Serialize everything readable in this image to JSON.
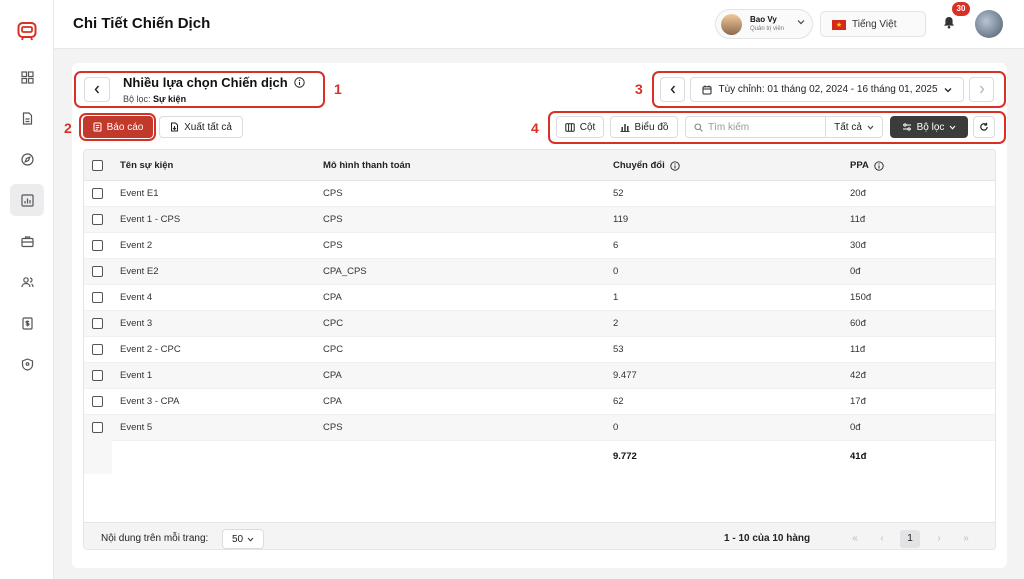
{
  "header": {
    "title": "Chi Tiết Chiến Dịch",
    "user_name": "Bao Vy",
    "user_role": "Quản trị viên",
    "language": "Tiếng Việt",
    "notifications": "30"
  },
  "annotations": [
    "1",
    "2",
    "3",
    "4"
  ],
  "campaign": {
    "title": "Nhiều lựa chọn Chiến dịch",
    "filter_label": "Bộ lọc:",
    "filter_value": "Sự kiện"
  },
  "date_range": "Tùy chỉnh: 01 tháng 02, 2024 - 16 tháng 01, 2025",
  "toolbar": {
    "report": "Báo cáo",
    "export_all": "Xuất tất cả",
    "columns": "Cột",
    "chart": "Biểu đồ",
    "search_placeholder": "Tìm kiếm",
    "scope": "Tất cả",
    "filter": "Bộ lọc"
  },
  "table": {
    "headers": [
      "Tên sự kiện",
      "Mô hình thanh toán",
      "Chuyển đổi",
      "PPA"
    ],
    "rows": [
      [
        "Event E1",
        "CPS",
        "52",
        "20đ"
      ],
      [
        "Event 1 - CPS",
        "CPS",
        "119",
        "11đ"
      ],
      [
        "Event 2",
        "CPS",
        "6",
        "30đ"
      ],
      [
        "Event E2",
        "CPA_CPS",
        "0",
        "0đ"
      ],
      [
        "Event 4",
        "CPA",
        "1",
        "150đ"
      ],
      [
        "Event 3",
        "CPC",
        "2",
        "60đ"
      ],
      [
        "Event 2 - CPC",
        "CPC",
        "53",
        "11đ"
      ],
      [
        "Event 1",
        "CPA",
        "9.477",
        "42đ"
      ],
      [
        "Event 3 - CPA",
        "CPA",
        "62",
        "17đ"
      ],
      [
        "Event 5",
        "CPS",
        "0",
        "0đ"
      ]
    ],
    "total": {
      "conversions": "9.772",
      "ppa": "41đ"
    }
  },
  "pagination": {
    "per_page_label": "Nội dung trên mỗi trang:",
    "per_page": "50",
    "range": "1 - 10 của 10 hàng",
    "current_page": "1"
  },
  "colors": {
    "accent": "#d93025",
    "dark_button": "#3b3b3b"
  }
}
